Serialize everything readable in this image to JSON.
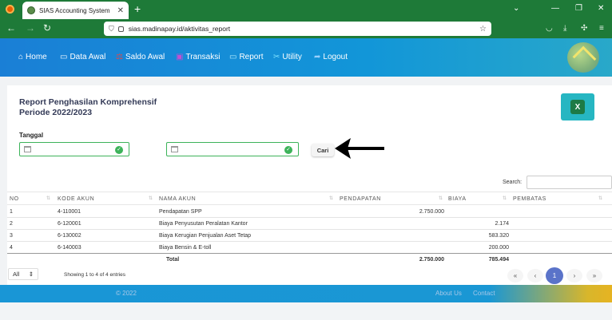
{
  "browser": {
    "tab_title": "SIAS Accounting System",
    "url": "sias.madinapay.id/aktivitas_report"
  },
  "menu": [
    {
      "label": "Home",
      "icon": "home-icon"
    },
    {
      "label": "Data Awal",
      "icon": "monitor-icon"
    },
    {
      "label": "Saldo Awal",
      "icon": "scale-icon"
    },
    {
      "label": "Transaksi",
      "icon": "transaction-icon"
    },
    {
      "label": "Report",
      "icon": "report-icon"
    },
    {
      "label": "Utility",
      "icon": "tools-icon"
    },
    {
      "label": "Logout",
      "icon": "logout-icon"
    }
  ],
  "report": {
    "title_line1": "Report Penghasilan Komprehensif",
    "title_line2": "Periode 2022/2023",
    "tanggal_label": "Tanggal",
    "date_from": "",
    "date_to": "",
    "cari_label": "Cari",
    "search_label": "Search:",
    "search_value": ""
  },
  "table": {
    "headers": [
      "NO",
      "KODE AKUN",
      "NAMA AKUN",
      "PENDAPATAN",
      "BIAYA",
      "PEMBATAS"
    ],
    "rows": [
      {
        "no": "1",
        "kode": "4-110001",
        "nama": "Pendapatan SPP",
        "pendapatan": "2.750.000",
        "biaya": "",
        "pembatas": ""
      },
      {
        "no": "2",
        "kode": "6-120001",
        "nama": "Biaya Penyusutan Peralatan Kantor",
        "pendapatan": "",
        "biaya": "2.174",
        "pembatas": ""
      },
      {
        "no": "3",
        "kode": "6-130002",
        "nama": "Biaya Kerugian Penjualan Aset Tetap",
        "pendapatan": "",
        "biaya": "583.320",
        "pembatas": ""
      },
      {
        "no": "4",
        "kode": "6-140003",
        "nama": "Biaya Bensin & E-toll",
        "pendapatan": "",
        "biaya": "200.000",
        "pembatas": ""
      }
    ],
    "total_label": "Total",
    "total_pendapatan": "2.750.000",
    "total_biaya": "785.494"
  },
  "footer_controls": {
    "page_length": "All",
    "info": "Showing 1 to 4 of 4 entries",
    "first": "«",
    "prev": "‹",
    "current_page": "1",
    "next": "›",
    "last": "»"
  },
  "footer": {
    "copyright": "© 2022",
    "about": "About Us",
    "contact": "Contact"
  }
}
